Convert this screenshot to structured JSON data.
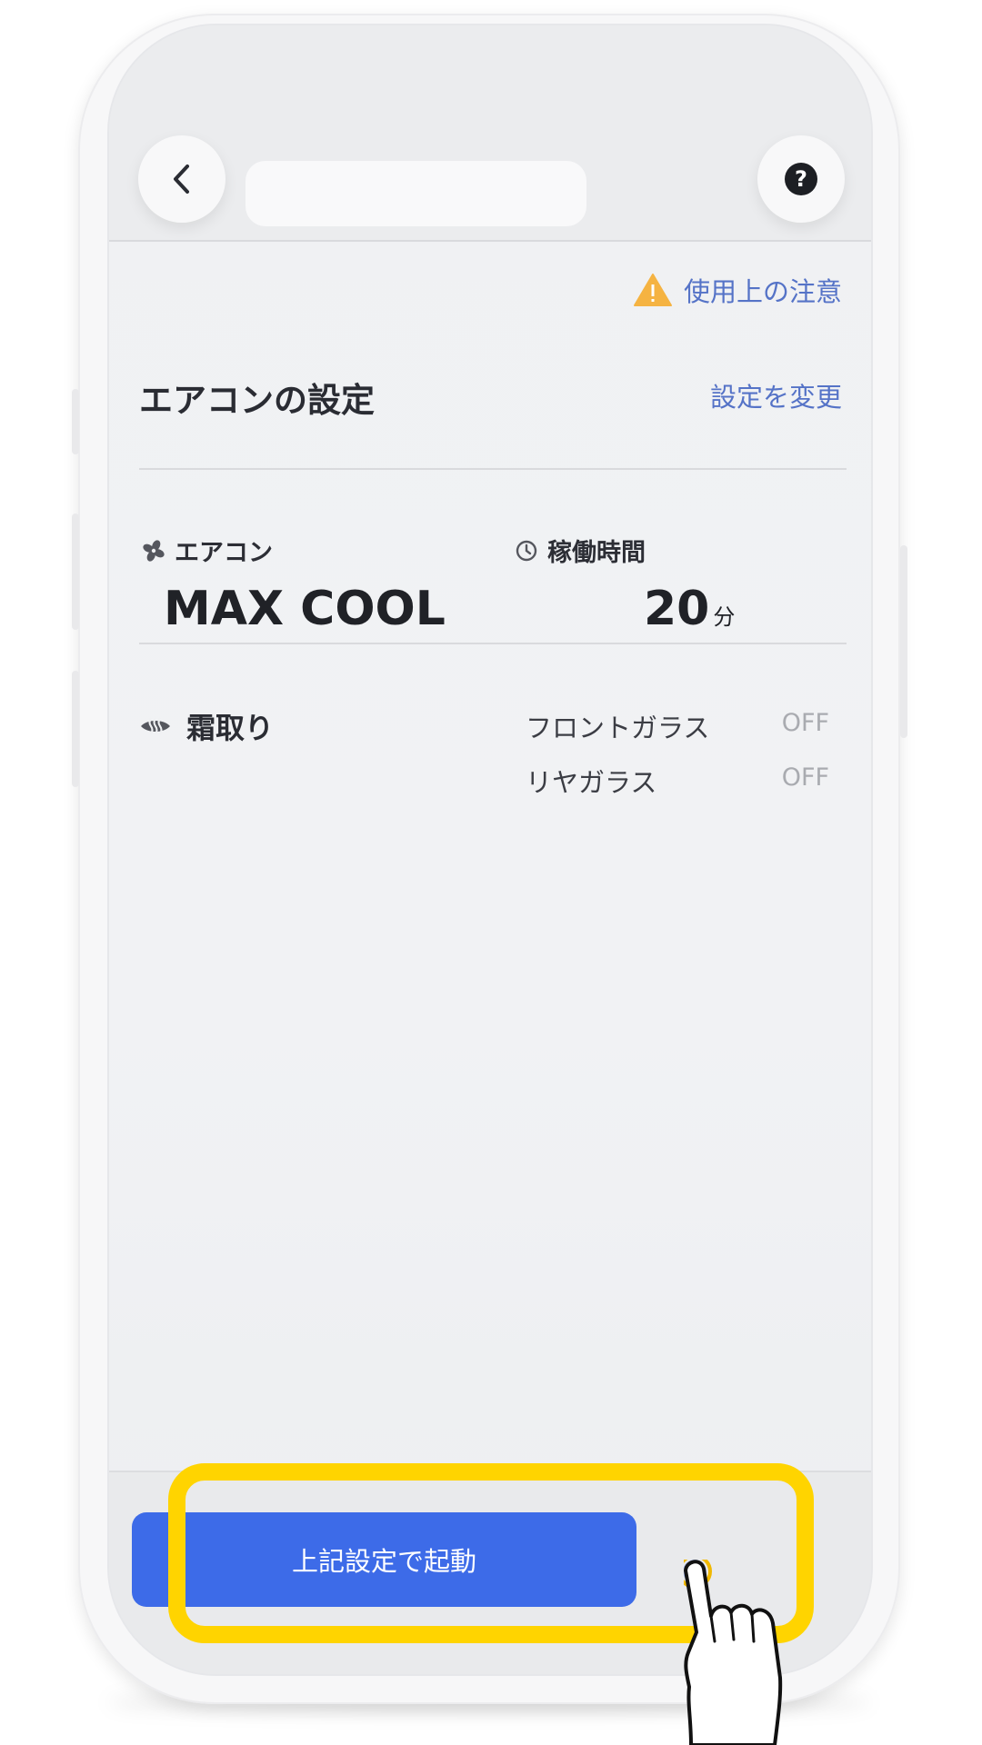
{
  "header": {
    "back_icon": "chevron-left-icon",
    "help_icon": "question-circle-icon",
    "help_glyph": "?"
  },
  "caution": {
    "icon": "warning-triangle-icon",
    "label": "使用上の注意"
  },
  "ac_settings": {
    "title": "エアコンの設定",
    "change_link": "設定を変更",
    "aircon": {
      "icon": "fan-icon",
      "label": "エアコン",
      "value": "MAX COOL"
    },
    "duration": {
      "icon": "clock-icon",
      "label": "稼働時間",
      "value": "20",
      "unit": "分"
    }
  },
  "defrost": {
    "icon": "defrost-icon",
    "title": "霜取り",
    "items": [
      {
        "label": "フロントガラス",
        "value": "OFF"
      },
      {
        "label": "リヤガラス",
        "value": "OFF"
      }
    ]
  },
  "footer": {
    "start_button_label": "上記設定で起動"
  },
  "colors": {
    "accent": "#3d6be8",
    "link": "#5573c7",
    "highlight": "#ffd400",
    "warning": "#f5b342"
  }
}
